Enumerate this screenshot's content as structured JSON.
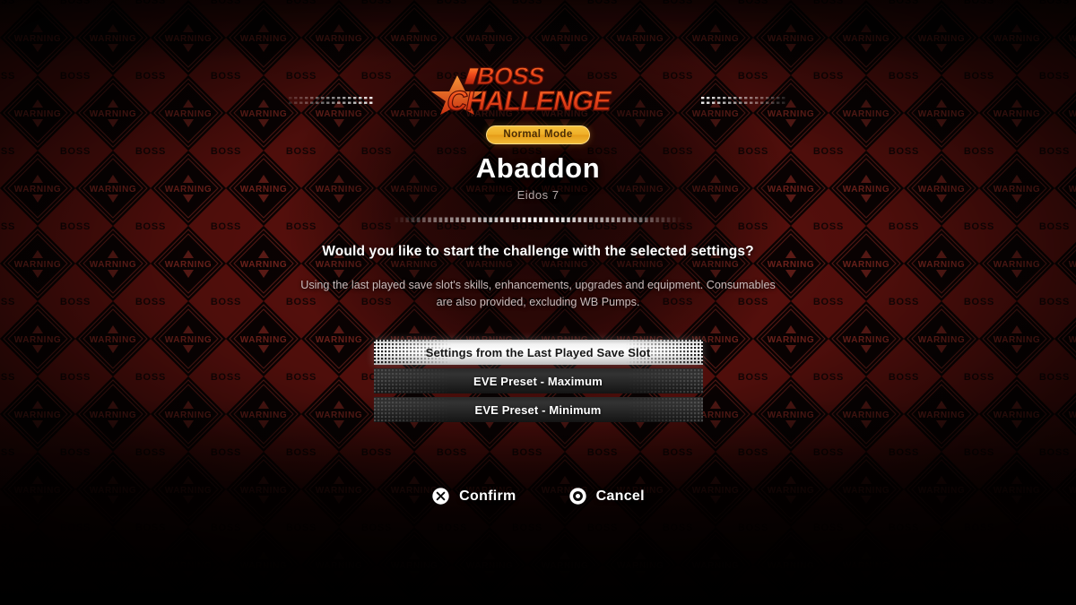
{
  "background": {
    "pattern_labels": {
      "diamond_red": "BOSS",
      "diamond_dark": "WARNING"
    },
    "colors": {
      "red": "#6e1410",
      "dark": "#0d0303",
      "line": "#8f2a22"
    }
  },
  "header": {
    "logo_line1": "BOSS",
    "logo_line2": "CHALLENGE",
    "logo_color": "#e8411c",
    "mode_badge": "Normal Mode",
    "mode_badge_color": "#efae27"
  },
  "boss": {
    "name": "Abaddon",
    "location": "Eidos 7"
  },
  "prompt": {
    "question": "Would you like to start the challenge with the selected settings?",
    "description": "Using the last played save slot's skills, enhancements, upgrades and equipment. Consumables are also provided, excluding WB Pumps."
  },
  "options": [
    {
      "label": "Settings from the Last Played Save Slot",
      "selected": true
    },
    {
      "label": "EVE Preset - Maximum",
      "selected": false
    },
    {
      "label": "EVE Preset - Minimum",
      "selected": false
    }
  ],
  "actions": [
    {
      "label": "Confirm",
      "icon": "cross-button-icon"
    },
    {
      "label": "Cancel",
      "icon": "circle-button-icon"
    }
  ]
}
